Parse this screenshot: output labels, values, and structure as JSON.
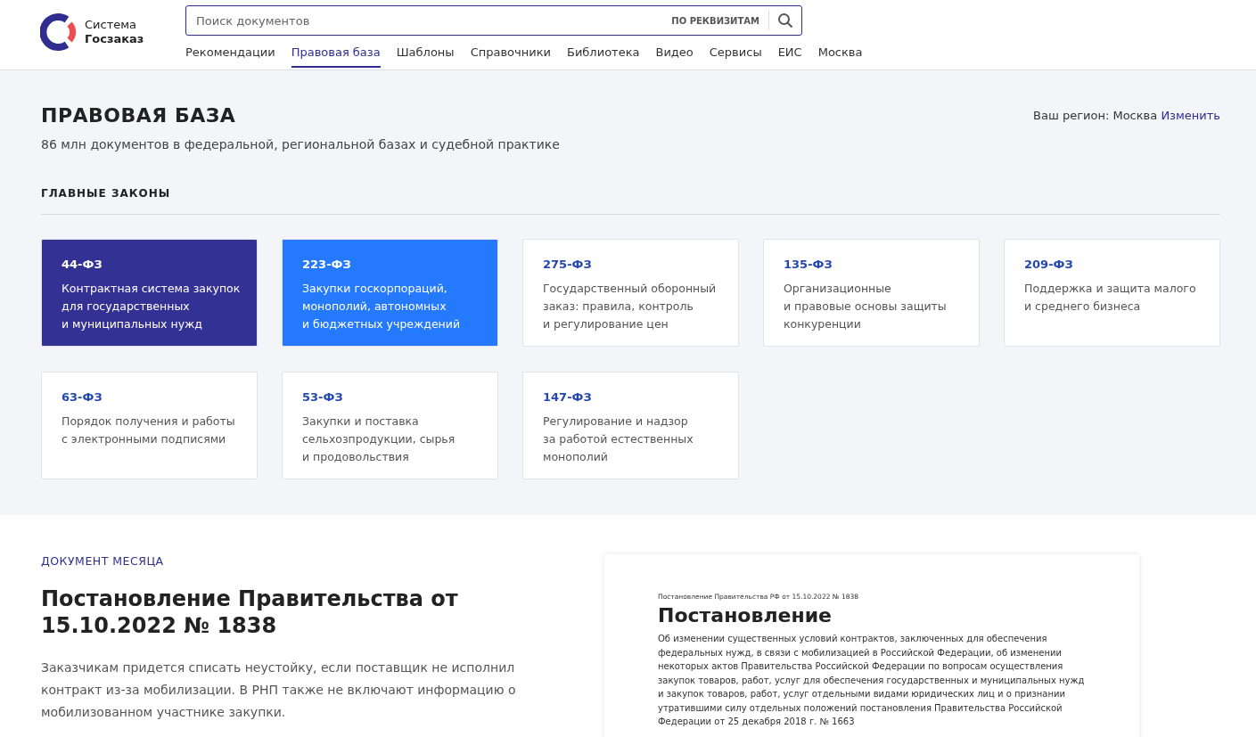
{
  "logo": {
    "line1": "Система",
    "line2": "Госзаказ"
  },
  "search": {
    "placeholder": "Поиск документов",
    "details_link": "ПО РЕКВИЗИТАМ"
  },
  "nav": [
    {
      "label": "Рекомендации",
      "selected": false
    },
    {
      "label": "Правовая база",
      "selected": true
    },
    {
      "label": "Шаблоны",
      "selected": false
    },
    {
      "label": "Справочники",
      "selected": false
    },
    {
      "label": "Библиотека",
      "selected": false
    },
    {
      "label": "Видео",
      "selected": false
    },
    {
      "label": "Сервисы",
      "selected": false
    },
    {
      "label": "ЕИС",
      "selected": false
    },
    {
      "label": "Москва",
      "selected": false
    }
  ],
  "page": {
    "title": "ПРАВОВАЯ БАЗА",
    "subtitle": "86 млн документов в федеральной, региональной базах и судебной практике",
    "region_label": "Ваш регион: Москва",
    "region_link": "Изменить"
  },
  "main_laws": {
    "heading": "ГЛАВНЫЕ ЗАКОНЫ",
    "cards": [
      {
        "kind": "dark",
        "code": "44-ФЗ",
        "lines": [
          "Контрактная система закупок",
          "для государственных",
          "и муниципальных нужд"
        ]
      },
      {
        "kind": "bright",
        "code": "223-ФЗ",
        "lines": [
          "Закупки госкорпораций,",
          "монополий, автономных",
          "и бюджетных учреждений"
        ]
      },
      {
        "kind": "plain",
        "code": "275-ФЗ",
        "lines": [
          "Государственный оборонный",
          "заказ: правила, контроль",
          "и регулирование цен"
        ]
      },
      {
        "kind": "plain",
        "code": "135-ФЗ",
        "lines": [
          "Организационные",
          "и правовые основы защиты",
          "конкуренции"
        ]
      },
      {
        "kind": "plain",
        "code": "209-ФЗ",
        "lines": [
          "Поддержка и защита малого",
          "и среднего бизнеса"
        ]
      },
      {
        "kind": "plain",
        "code": "63-ФЗ",
        "lines": [
          "Порядок получения и работы",
          "с электронными подписями"
        ]
      },
      {
        "kind": "plain",
        "code": "53-ФЗ",
        "lines": [
          "Закупки и поставка",
          "сельхозпродукции, сырья",
          "и продовольствия"
        ]
      },
      {
        "kind": "plain",
        "code": "147-ФЗ",
        "lines": [
          "Регулирование и надзор",
          "за работой естественных",
          "монополий"
        ]
      }
    ]
  },
  "document_of_month": {
    "label": "ДОКУМЕНТ МЕСЯЦА",
    "title": "Постановление Правительства от 15.10.2022 № 1838",
    "summary": "Заказчикам придется списать неустойку, если поставщик не исполнил контракт из-за мобилизации. В РНП также не включают информацию о мобилизованном участнике закупки.",
    "preview": {
      "caption": "Постановление Правительства РФ от 15.10.2022 № 1838",
      "heading": "Постановление",
      "text": "Об изменении существенных условий контрактов, заключенных для обеспечения федеральных нужд, в связи с мобилизацией в Российской Федерации, об изменении некоторых актов Правительства Российской Федерации по вопросам осуществления закупок товаров, работ, услуг для обеспечения государственных и муниципальных нужд и закупок товаров, работ, услуг отдельными видами юридических лиц и о признании утратившими силу отдельных положений постановления Правительства Российской Федерации от 25 декабря 2018 г. № 1663"
    }
  }
}
